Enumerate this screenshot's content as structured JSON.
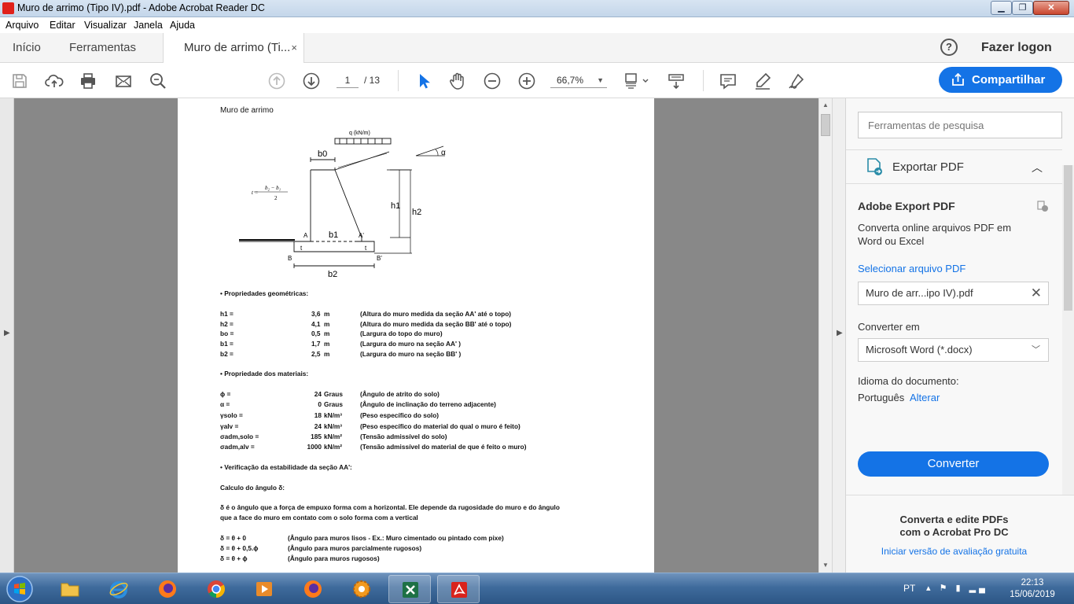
{
  "window": {
    "title": "Muro de arrimo (Tipo IV).pdf - Adobe Acrobat Reader DC",
    "minimize": "▁",
    "maximize": "❐",
    "close": "✕"
  },
  "menu": [
    "Arquivo",
    "Editar",
    "Visualizar",
    "Janela",
    "Ajuda"
  ],
  "tabs": {
    "home": "Início",
    "tools": "Ferramentas",
    "document": "Muro de arrimo (Ti...",
    "close": "×"
  },
  "header": {
    "help": "?",
    "login": "Fazer logon"
  },
  "toolbar": {
    "page_current": "1",
    "page_total": "/ 13",
    "zoom": "66,7%",
    "share": "Compartilhar"
  },
  "document": {
    "heading": "Muro de arrimo",
    "figure": {
      "q_label": "q (kN/m)",
      "alpha": "α",
      "b0": "b0",
      "b1": "b1",
      "b2": "b2",
      "h1": "h1",
      "h2": "h2",
      "A": "A",
      "A_prime": "A'",
      "B": "B",
      "B_prime": "B'",
      "t_left": "t",
      "t_right": "t",
      "formula_lhs": "t =",
      "formula_num": "b₂ − b₁",
      "formula_den": "2"
    },
    "geom_title": "• Propriedades geométricas:",
    "geom": [
      {
        "name": "h1 =",
        "value": "3,6",
        "unit": "m",
        "desc": "(Altura do muro medida da seção AA' até o topo)"
      },
      {
        "name": "h2 =",
        "value": "4,1",
        "unit": "m",
        "desc": "(Altura do muro medida da seção BB' até o topo)"
      },
      {
        "name": "bo =",
        "value": "0,5",
        "unit": "m",
        "desc": "(Largura do topo do muro)"
      },
      {
        "name": "b1 =",
        "value": "1,7",
        "unit": "m",
        "desc": "(Largura do muro na seção AA' )"
      },
      {
        "name": "b2 =",
        "value": "2,5",
        "unit": "m",
        "desc": "(Largura do muro na seção BB' )"
      }
    ],
    "mat_title": "• Propriedade dos materiais:",
    "mat": [
      {
        "name": "ϕ =",
        "value": "24",
        "unit": "Graus",
        "desc": "(Ângulo de atrito do solo)"
      },
      {
        "name": "α =",
        "value": "0",
        "unit": "Graus",
        "desc": "(Ângulo de inclinação do terreno adjacente)"
      },
      {
        "name": "γsolo =",
        "value": "18",
        "unit": "kN/m³",
        "desc": "(Peso específico do solo)"
      },
      {
        "name": "γalv =",
        "value": "24",
        "unit": "kN/m³",
        "desc": "(Peso específico do material do qual o muro é feito)"
      },
      {
        "name": "σadm,solo =",
        "value": "185",
        "unit": "kN/m²",
        "desc": "(Tensão admissível do solo)"
      },
      {
        "name": "σadm,alv =",
        "value": "1000",
        "unit": "kN/m²",
        "desc": "(Tensão admissível do material de que é feito o muro)"
      }
    ],
    "verif_title": "• Verificação da estabilidade da seção AA':",
    "calc_title": "Calculo do ângulo δ:",
    "para1": "δ é o ângulo que a força de empuxo forma com a horizontal. Ele depende da rugosidade do muro e do ângulo",
    "para2": "que a face do muro em contato com o solo forma com a vertical",
    "cases": [
      {
        "eq": "δ = θ + 0",
        "desc": "(Ângulo para muros lisos - Ex.: Muro cimentado ou pintado com pixe)"
      },
      {
        "eq": "δ = θ + 0,5.ϕ",
        "desc": "(Ângulo para muros parcialmente rugosos)"
      },
      {
        "eq": "δ = θ + ϕ",
        "desc": "(Ângulo para muros rugosos)"
      }
    ]
  },
  "pane": {
    "search_placeholder": "Ferramentas de pesquisa",
    "export_label": "Exportar PDF",
    "service_title": "Adobe Export PDF",
    "service_desc1": "Converta online arquivos PDF em",
    "service_desc2": "Word ou Excel",
    "select_file": "Selecionar arquivo PDF",
    "file_name": "Muro de arr...ipo IV).pdf",
    "convert_to": "Converter em",
    "format": "Microsoft Word (*.docx)",
    "lang_label": "Idioma do documento:",
    "lang_value": "Português",
    "lang_change": "Alterar",
    "convert_button": "Converter",
    "promo1": "Converta e edite PDFs",
    "promo2": "com o Acrobat Pro DC",
    "trial": "Iniciar versão de avaliação gratuita"
  },
  "taskbar": {
    "lang": "PT",
    "time": "22:13",
    "date": "15/06/2019"
  },
  "colors": {
    "accent": "#1473e6",
    "acrobat_red": "#e0211b"
  }
}
